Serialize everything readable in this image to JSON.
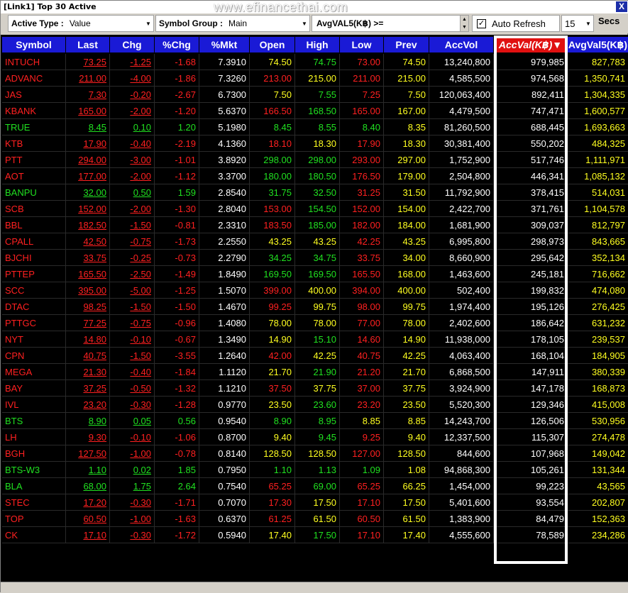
{
  "window": {
    "title": "[Link1] Top 30 Active",
    "watermark": "www.efinancethai.com",
    "close_label": "X"
  },
  "toolbar": {
    "active_type_label": "Active Type :",
    "active_type_value": "Value",
    "symbol_group_label": "Symbol Group :",
    "symbol_group_value": "Main",
    "avg_label": "AvgVAL5(K฿) >=",
    "avg_value": "",
    "auto_refresh_label": "Auto Refresh",
    "auto_refresh_checked": "✓",
    "refresh_seconds": "15",
    "secs_label": "Secs"
  },
  "columns": [
    "Symbol",
    "Last",
    "Chg",
    "%Chg",
    "%Mkt",
    "Open",
    "High",
    "Low",
    "Prev",
    "AccVol",
    "AccVal(K฿)",
    "AvgVal5(K฿)"
  ],
  "rows": [
    {
      "s": "INTUCH",
      "c": "r",
      "last": "73.25",
      "chg": "-1.25",
      "pchg": "-1.68",
      "mkt": "7.3910",
      "open": "74.50",
      "oc": "y",
      "high": "74.75",
      "hc": "g",
      "low": "73.00",
      "lc": "r",
      "prev": "74.50",
      "vol": "13,240,800",
      "val": "979,985",
      "avg": "827,783"
    },
    {
      "s": "ADVANC",
      "c": "r",
      "last": "211.00",
      "chg": "-4.00",
      "pchg": "-1.86",
      "mkt": "7.3260",
      "open": "213.00",
      "oc": "r",
      "high": "215.00",
      "hc": "y",
      "low": "211.00",
      "lc": "r",
      "prev": "215.00",
      "vol": "4,585,500",
      "val": "974,568",
      "avg": "1,350,741"
    },
    {
      "s": "JAS",
      "c": "r",
      "last": "7.30",
      "chg": "-0.20",
      "pchg": "-2.67",
      "mkt": "6.7300",
      "open": "7.50",
      "oc": "y",
      "high": "7.55",
      "hc": "g",
      "low": "7.25",
      "lc": "r",
      "prev": "7.50",
      "vol": "120,063,400",
      "val": "892,411",
      "avg": "1,304,335"
    },
    {
      "s": "KBANK",
      "c": "r",
      "last": "165.00",
      "chg": "-2.00",
      "pchg": "-1.20",
      "mkt": "5.6370",
      "open": "166.50",
      "oc": "r",
      "high": "168.50",
      "hc": "g",
      "low": "165.00",
      "lc": "r",
      "prev": "167.00",
      "vol": "4,479,500",
      "val": "747,471",
      "avg": "1,600,577"
    },
    {
      "s": "TRUE",
      "c": "g",
      "last": "8.45",
      "chg": "0.10",
      "pchg": "1.20",
      "mkt": "5.1980",
      "open": "8.45",
      "oc": "g",
      "high": "8.55",
      "hc": "g",
      "low": "8.40",
      "lc": "g",
      "prev": "8.35",
      "vol": "81,260,500",
      "val": "688,445",
      "avg": "1,693,663"
    },
    {
      "s": "KTB",
      "c": "r",
      "last": "17.90",
      "chg": "-0.40",
      "pchg": "-2.19",
      "mkt": "4.1360",
      "open": "18.10",
      "oc": "r",
      "high": "18.30",
      "hc": "y",
      "low": "17.90",
      "lc": "r",
      "prev": "18.30",
      "vol": "30,381,400",
      "val": "550,202",
      "avg": "484,325"
    },
    {
      "s": "PTT",
      "c": "r",
      "last": "294.00",
      "chg": "-3.00",
      "pchg": "-1.01",
      "mkt": "3.8920",
      "open": "298.00",
      "oc": "g",
      "high": "298.00",
      "hc": "g",
      "low": "293.00",
      "lc": "r",
      "prev": "297.00",
      "vol": "1,752,900",
      "val": "517,746",
      "avg": "1,111,971"
    },
    {
      "s": "AOT",
      "c": "r",
      "last": "177.00",
      "chg": "-2.00",
      "pchg": "-1.12",
      "mkt": "3.3700",
      "open": "180.00",
      "oc": "g",
      "high": "180.50",
      "hc": "g",
      "low": "176.50",
      "lc": "r",
      "prev": "179.00",
      "vol": "2,504,800",
      "val": "446,341",
      "avg": "1,085,132"
    },
    {
      "s": "BANPU",
      "c": "g",
      "last": "32.00",
      "chg": "0.50",
      "pchg": "1.59",
      "mkt": "2.8540",
      "open": "31.75",
      "oc": "g",
      "high": "32.50",
      "hc": "g",
      "low": "31.25",
      "lc": "r",
      "prev": "31.50",
      "vol": "11,792,900",
      "val": "378,415",
      "avg": "514,031"
    },
    {
      "s": "SCB",
      "c": "r",
      "last": "152.00",
      "chg": "-2.00",
      "pchg": "-1.30",
      "mkt": "2.8040",
      "open": "153.00",
      "oc": "r",
      "high": "154.50",
      "hc": "g",
      "low": "152.00",
      "lc": "r",
      "prev": "154.00",
      "vol": "2,422,700",
      "val": "371,761",
      "avg": "1,104,578"
    },
    {
      "s": "BBL",
      "c": "r",
      "last": "182.50",
      "chg": "-1.50",
      "pchg": "-0.81",
      "mkt": "2.3310",
      "open": "183.50",
      "oc": "r",
      "high": "185.00",
      "hc": "g",
      "low": "182.00",
      "lc": "r",
      "prev": "184.00",
      "vol": "1,681,900",
      "val": "309,037",
      "avg": "812,797"
    },
    {
      "s": "CPALL",
      "c": "r",
      "last": "42.50",
      "chg": "-0.75",
      "pchg": "-1.73",
      "mkt": "2.2550",
      "open": "43.25",
      "oc": "y",
      "high": "43.25",
      "hc": "y",
      "low": "42.25",
      "lc": "r",
      "prev": "43.25",
      "vol": "6,995,800",
      "val": "298,973",
      "avg": "843,665"
    },
    {
      "s": "BJCHI",
      "c": "r",
      "last": "33.75",
      "chg": "-0.25",
      "pchg": "-0.73",
      "mkt": "2.2790",
      "open": "34.25",
      "oc": "g",
      "high": "34.75",
      "hc": "g",
      "low": "33.75",
      "lc": "r",
      "prev": "34.00",
      "vol": "8,660,900",
      "val": "295,642",
      "avg": "352,134"
    },
    {
      "s": "PTTEP",
      "c": "r",
      "last": "165.50",
      "chg": "-2.50",
      "pchg": "-1.49",
      "mkt": "1.8490",
      "open": "169.50",
      "oc": "g",
      "high": "169.50",
      "hc": "g",
      "low": "165.50",
      "lc": "r",
      "prev": "168.00",
      "vol": "1,463,600",
      "val": "245,181",
      "avg": "716,662"
    },
    {
      "s": "SCC",
      "c": "r",
      "last": "395.00",
      "chg": "-5.00",
      "pchg": "-1.25",
      "mkt": "1.5070",
      "open": "399.00",
      "oc": "r",
      "high": "400.00",
      "hc": "y",
      "low": "394.00",
      "lc": "r",
      "prev": "400.00",
      "vol": "502,400",
      "val": "199,832",
      "avg": "474,080"
    },
    {
      "s": "DTAC",
      "c": "r",
      "last": "98.25",
      "chg": "-1.50",
      "pchg": "-1.50",
      "mkt": "1.4670",
      "open": "99.25",
      "oc": "r",
      "high": "99.75",
      "hc": "y",
      "low": "98.00",
      "lc": "r",
      "prev": "99.75",
      "vol": "1,974,400",
      "val": "195,126",
      "avg": "276,425"
    },
    {
      "s": "PTTGC",
      "c": "r",
      "last": "77.25",
      "chg": "-0.75",
      "pchg": "-0.96",
      "mkt": "1.4080",
      "open": "78.00",
      "oc": "y",
      "high": "78.00",
      "hc": "y",
      "low": "77.00",
      "lc": "r",
      "prev": "78.00",
      "vol": "2,402,600",
      "val": "186,642",
      "avg": "631,232"
    },
    {
      "s": "NYT",
      "c": "r",
      "last": "14.80",
      "chg": "-0.10",
      "pchg": "-0.67",
      "mkt": "1.3490",
      "open": "14.90",
      "oc": "y",
      "high": "15.10",
      "hc": "g",
      "low": "14.60",
      "lc": "r",
      "prev": "14.90",
      "vol": "11,938,000",
      "val": "178,105",
      "avg": "239,537"
    },
    {
      "s": "CPN",
      "c": "r",
      "last": "40.75",
      "chg": "-1.50",
      "pchg": "-3.55",
      "mkt": "1.2640",
      "open": "42.00",
      "oc": "r",
      "high": "42.25",
      "hc": "y",
      "low": "40.75",
      "lc": "r",
      "prev": "42.25",
      "vol": "4,063,400",
      "val": "168,104",
      "avg": "184,905"
    },
    {
      "s": "MEGA",
      "c": "r",
      "last": "21.30",
      "chg": "-0.40",
      "pchg": "-1.84",
      "mkt": "1.1120",
      "open": "21.70",
      "oc": "y",
      "high": "21.90",
      "hc": "g",
      "low": "21.20",
      "lc": "r",
      "prev": "21.70",
      "vol": "6,868,500",
      "val": "147,911",
      "avg": "380,339"
    },
    {
      "s": "BAY",
      "c": "r",
      "last": "37.25",
      "chg": "-0.50",
      "pchg": "-1.32",
      "mkt": "1.1210",
      "open": "37.50",
      "oc": "r",
      "high": "37.75",
      "hc": "y",
      "low": "37.00",
      "lc": "r",
      "prev": "37.75",
      "vol": "3,924,900",
      "val": "147,178",
      "avg": "168,873"
    },
    {
      "s": "IVL",
      "c": "r",
      "last": "23.20",
      "chg": "-0.30",
      "pchg": "-1.28",
      "mkt": "0.9770",
      "open": "23.50",
      "oc": "y",
      "high": "23.60",
      "hc": "g",
      "low": "23.20",
      "lc": "r",
      "prev": "23.50",
      "vol": "5,520,300",
      "val": "129,346",
      "avg": "415,008"
    },
    {
      "s": "BTS",
      "c": "g",
      "last": "8.90",
      "chg": "0.05",
      "pchg": "0.56",
      "mkt": "0.9540",
      "open": "8.90",
      "oc": "g",
      "high": "8.95",
      "hc": "g",
      "low": "8.85",
      "lc": "y",
      "prev": "8.85",
      "vol": "14,243,700",
      "val": "126,506",
      "avg": "530,956"
    },
    {
      "s": "LH",
      "c": "r",
      "last": "9.30",
      "chg": "-0.10",
      "pchg": "-1.06",
      "mkt": "0.8700",
      "open": "9.40",
      "oc": "y",
      "high": "9.45",
      "hc": "g",
      "low": "9.25",
      "lc": "r",
      "prev": "9.40",
      "vol": "12,337,500",
      "val": "115,307",
      "avg": "274,478"
    },
    {
      "s": "BGH",
      "c": "r",
      "last": "127.50",
      "chg": "-1.00",
      "pchg": "-0.78",
      "mkt": "0.8140",
      "open": "128.50",
      "oc": "y",
      "high": "128.50",
      "hc": "y",
      "low": "127.00",
      "lc": "r",
      "prev": "128.50",
      "vol": "844,600",
      "val": "107,968",
      "avg": "149,042"
    },
    {
      "s": "BTS-W3",
      "c": "g",
      "last": "1.10",
      "chg": "0.02",
      "pchg": "1.85",
      "mkt": "0.7950",
      "open": "1.10",
      "oc": "g",
      "high": "1.13",
      "hc": "g",
      "low": "1.09",
      "lc": "g",
      "prev": "1.08",
      "vol": "94,868,300",
      "val": "105,261",
      "avg": "131,344"
    },
    {
      "s": "BLA",
      "c": "g",
      "last": "68.00",
      "chg": "1.75",
      "pchg": "2.64",
      "mkt": "0.7540",
      "open": "65.25",
      "oc": "r",
      "high": "69.00",
      "hc": "g",
      "low": "65.25",
      "lc": "r",
      "prev": "66.25",
      "vol": "1,454,000",
      "val": "99,223",
      "avg": "43,565"
    },
    {
      "s": "STEC",
      "c": "r",
      "last": "17.20",
      "chg": "-0.30",
      "pchg": "-1.71",
      "mkt": "0.7070",
      "open": "17.30",
      "oc": "r",
      "high": "17.50",
      "hc": "y",
      "low": "17.10",
      "lc": "r",
      "prev": "17.50",
      "vol": "5,401,600",
      "val": "93,554",
      "avg": "202,807"
    },
    {
      "s": "TOP",
      "c": "r",
      "last": "60.50",
      "chg": "-1.00",
      "pchg": "-1.63",
      "mkt": "0.6370",
      "open": "61.25",
      "oc": "r",
      "high": "61.50",
      "hc": "y",
      "low": "60.50",
      "lc": "r",
      "prev": "61.50",
      "vol": "1,383,900",
      "val": "84,479",
      "avg": "152,363"
    },
    {
      "s": "CK",
      "c": "r",
      "last": "17.10",
      "chg": "-0.30",
      "pchg": "-1.72",
      "mkt": "0.5940",
      "open": "17.40",
      "oc": "y",
      "high": "17.50",
      "hc": "g",
      "low": "17.10",
      "lc": "r",
      "prev": "17.40",
      "vol": "4,555,600",
      "val": "78,589",
      "avg": "234,286"
    }
  ],
  "colors": {
    "header_bg": "#1a1ad6",
    "sorted_header_bg": "#e01010",
    "grid_bg": "#000000",
    "up": "#20e020",
    "down": "#ff2020",
    "unchanged": "#ffff20",
    "neutral": "#ffffff"
  }
}
